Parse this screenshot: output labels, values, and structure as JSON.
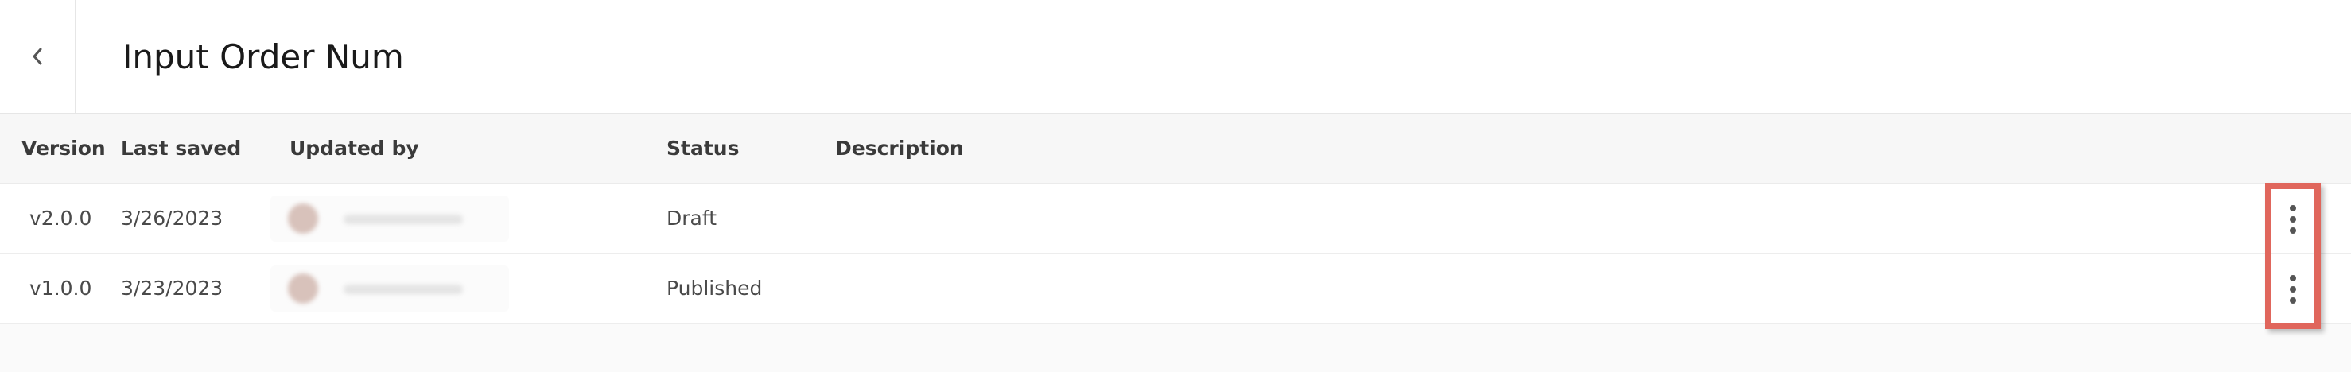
{
  "header": {
    "title": "Input Order Num",
    "back_icon": "chevron-left-icon"
  },
  "table": {
    "columns": {
      "version": "Version",
      "last_saved": "Last saved",
      "updated_by": "Updated by",
      "status": "Status",
      "description": "Description"
    },
    "rows": [
      {
        "version": "v2.0.0",
        "last_saved": "3/26/2023",
        "status": "Draft",
        "description": ""
      },
      {
        "version": "v1.0.0",
        "last_saved": "3/23/2023",
        "status": "Published",
        "description": ""
      }
    ],
    "row_action_icon": "more-vertical-icon"
  },
  "colors": {
    "highlight": "#e0665c",
    "header_bg": "#ffffff",
    "table_header_bg": "#f7f7f7"
  }
}
